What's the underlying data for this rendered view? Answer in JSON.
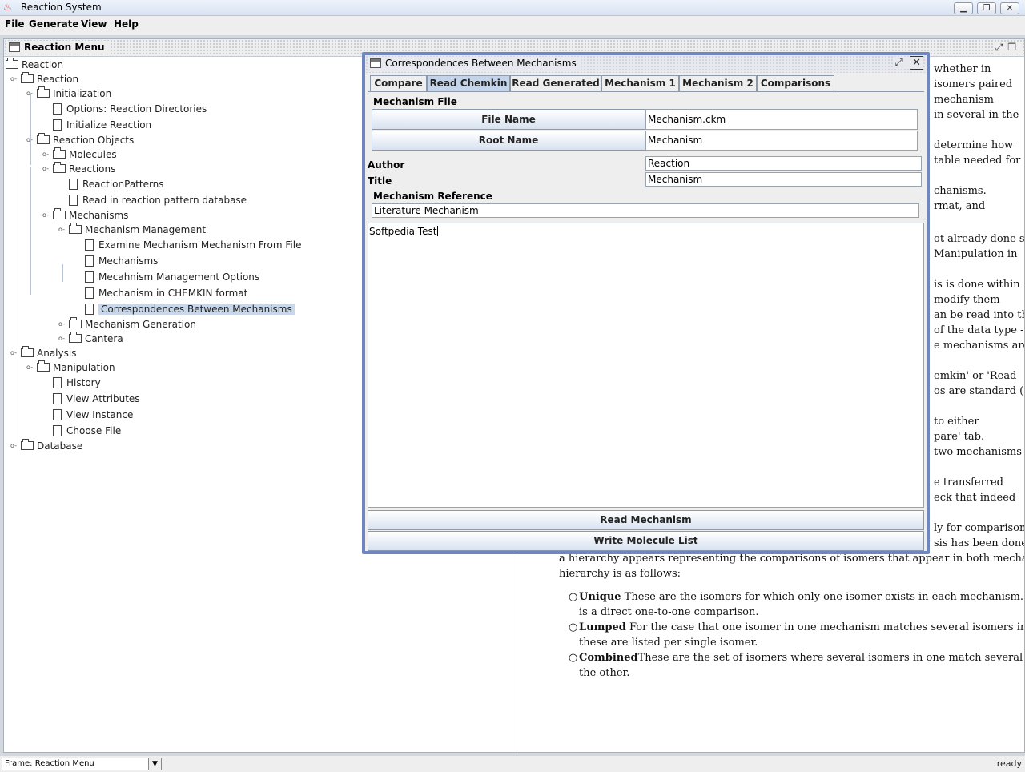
{
  "window": {
    "title": "Reaction System"
  },
  "menubar": [
    "File",
    "Generate",
    "View",
    "Help"
  ],
  "reaction_menu": {
    "title": "Reaction Menu",
    "tree": [
      {
        "label": "Reaction",
        "level": 0,
        "kind": "folder"
      },
      {
        "label": "Reaction",
        "level": 1,
        "kind": "folder"
      },
      {
        "label": "Initialization",
        "level": 2,
        "kind": "folder"
      },
      {
        "label": "Options: Reaction Directories",
        "level": 3,
        "kind": "doc"
      },
      {
        "label": "Initialize Reaction",
        "level": 3,
        "kind": "doc"
      },
      {
        "label": "Reaction Objects",
        "level": 2,
        "kind": "folder"
      },
      {
        "label": "Molecules",
        "level": 3,
        "kind": "folder"
      },
      {
        "label": "Reactions",
        "level": 3,
        "kind": "folder"
      },
      {
        "label": "ReactionPatterns",
        "level": 4,
        "kind": "doc"
      },
      {
        "label": "Read in reaction pattern database",
        "level": 4,
        "kind": "doc"
      },
      {
        "label": "Mechanisms",
        "level": 3,
        "kind": "folder"
      },
      {
        "label": "Mechanism Management",
        "level": 4,
        "kind": "folder"
      },
      {
        "label": "Examine Mechanism Mechanism From File",
        "level": 5,
        "kind": "doc"
      },
      {
        "label": "Mechanisms",
        "level": 5,
        "kind": "doc"
      },
      {
        "label": "Mecahnism Management Options",
        "level": 5,
        "kind": "doc"
      },
      {
        "label": "Mechanism in CHEMKIN format",
        "level": 5,
        "kind": "doc"
      },
      {
        "label": "Correspondences Between Mechanisms",
        "level": 5,
        "kind": "doc",
        "selected": true
      },
      {
        "label": "Mechanism Generation",
        "level": 4,
        "kind": "folder"
      },
      {
        "label": "Cantera",
        "level": 4,
        "kind": "folder"
      },
      {
        "label": "Analysis",
        "level": 1,
        "kind": "folder"
      },
      {
        "label": "Manipulation",
        "level": 2,
        "kind": "folder"
      },
      {
        "label": "History",
        "level": 3,
        "kind": "doc"
      },
      {
        "label": "View Attributes",
        "level": 3,
        "kind": "doc"
      },
      {
        "label": "View Instance",
        "level": 3,
        "kind": "doc"
      },
      {
        "label": "Choose File",
        "level": 3,
        "kind": "doc"
      },
      {
        "label": "Database",
        "level": 1,
        "kind": "folder"
      }
    ]
  },
  "help_text": {
    "right_fragments": [
      "whether in",
      "isomers paired",
      "mechanism",
      "in several in the",
      "",
      "determine how",
      "table needed for",
      "",
      "chanisms.",
      "rmat, and",
      "",
      "",
      "ot already done so,",
      "Manipulation in",
      "",
      "is is done within",
      "modify them",
      "an be read into the",
      "of the data type -",
      "e mechanisms are",
      "",
      "emkin' or 'Read",
      "os are standard (so",
      "",
      "to either",
      "pare' tab.",
      "two mechanisms",
      "",
      "e transferred",
      "eck that indeed",
      "",
      "ly for comparison.",
      "sis has been done,"
    ],
    "paragraph_lines": [
      "a hierarchy appears representing the comparisons of isomers that appear in both mechanisms.  The",
      "hierarchy is as follows:"
    ],
    "bullets": [
      {
        "term": "Unique",
        "lines": [
          " These are the isomers for which only one isomer exists in each mechanism. Thus there",
          "is a direct one-to-one comparison."
        ]
      },
      {
        "term": "Lumped",
        "lines": [
          " For the case that one isomer in one mechanism matches several isomers in the other,",
          "these are listed per single isomer."
        ]
      },
      {
        "term": "Combined",
        "lines": [
          "These are the set of isomers where several isomers in one match several isomers in",
          "the other."
        ]
      }
    ]
  },
  "correspondences": {
    "title": "Correspondences Between Mechanisms",
    "tabs": [
      "Compare",
      "Read Chemkin",
      "Read Generated",
      "Mechanism 1",
      "Mechanism 2",
      "Comparisons"
    ],
    "active_tab": "Read Chemkin",
    "mechanism_file_label": "Mechanism File",
    "file_name_button": "File Name",
    "file_name_value": "Mechanism.ckm",
    "root_name_button": "Root Name",
    "root_name_value": "Mechanism",
    "author_label": "Author",
    "author_value": "Reaction",
    "title_label": "Title",
    "title_value": "Mechanism",
    "reference_label": "Mechanism Reference",
    "reference_value": "Literature Mechanism",
    "notes_value": "Softpedia Test",
    "read_button": "Read Mechanism",
    "write_button": "Write Molecule List"
  },
  "statusbar": {
    "frame_select": "Frame: Reaction Menu",
    "status": "ready"
  }
}
